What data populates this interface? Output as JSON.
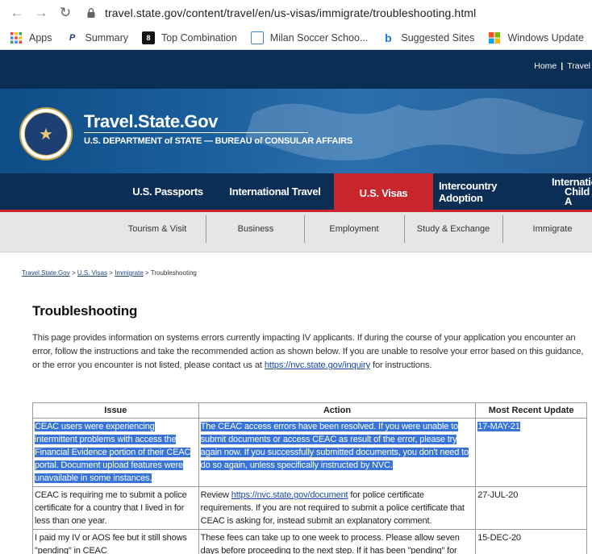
{
  "browser": {
    "url": "travel.state.gov/content/travel/en/us-visas/immigrate/troubleshooting.html",
    "bookmarks": [
      {
        "label": "Apps"
      },
      {
        "label": "Summary"
      },
      {
        "label": "Top Combination"
      },
      {
        "label": "Milan Soccer Schoo..."
      },
      {
        "label": "Suggested Sites"
      },
      {
        "label": "Windows Update"
      }
    ]
  },
  "site": {
    "top_links": {
      "home": "Home",
      "sep": "|",
      "travel": "Travel"
    },
    "title": "Travel.State.Gov",
    "subtitle": "U.S. DEPARTMENT of STATE — BUREAU of CONSULAR AFFAIRS",
    "main_nav": {
      "passports": "U.S. Passports",
      "international_travel": "International Travel",
      "visas": "U.S. Visas",
      "intercountry_adoption": "Intercountry Adoption",
      "international_child_1": "Internatio",
      "international_child_2": "Child A"
    },
    "sub_nav": {
      "tourism": "Tourism & Visit",
      "business": "Business",
      "employment": "Employment",
      "study": "Study & Exchange",
      "immigrate": "Immigrate"
    }
  },
  "breadcrumb": {
    "home": "Travel.State.Gov",
    "visas": "U.S. Visas",
    "immigrate": "Immigrate",
    "current": "Troubleshooting",
    "sep": ">"
  },
  "page": {
    "title": "Troubleshooting",
    "intro_text": "This page provides information on systems errors currently impacting IV applicants. If during the course of your application you encounter an error, follow the instructions and take the recommended action as shown below. If you are unable to resolve your error based on this guidance, or the error you encounter is not listed, please contact us at ",
    "intro_link": "https://nvc.state.gov/inquiry",
    "intro_tail": " for instructions."
  },
  "table": {
    "headers": {
      "issue": "Issue",
      "action": "Action",
      "updated": "Most Recent Update"
    },
    "rows": [
      {
        "issue": "CEAC users were experiencing intermittent problems with access the Financial Evidence portion of their CEAC portal. Document upload features were unavailable in some instances.",
        "action": "The CEAC access errors have been resolved. If you were unable to submit documents or access CEAC as result of the error, please try again now. If you successfully submitted documents, you don't need to do so again, unless specifically instructed by NVC.",
        "updated": "17-MAY-21"
      },
      {
        "issue": "CEAC is requiring me to submit a police certificate for a country that I lived in for less than one year.",
        "action_pre": "Review ",
        "action_link": "https://nvc.state.gov/document",
        "action_post": " for police certificate requirements. If you are not required to submit a police certificate that CEAC is asking for, instead submit an explanatory comment.",
        "updated": "27-JUL-20"
      },
      {
        "issue": "I paid my IV or AOS fee but it still shows \"pending\" in CEAC",
        "action": "These fees can take up to one week to process. Please allow seven days before proceeding to the next step. If it has been \"pending\" for",
        "updated": "15-DEC-20"
      }
    ]
  }
}
